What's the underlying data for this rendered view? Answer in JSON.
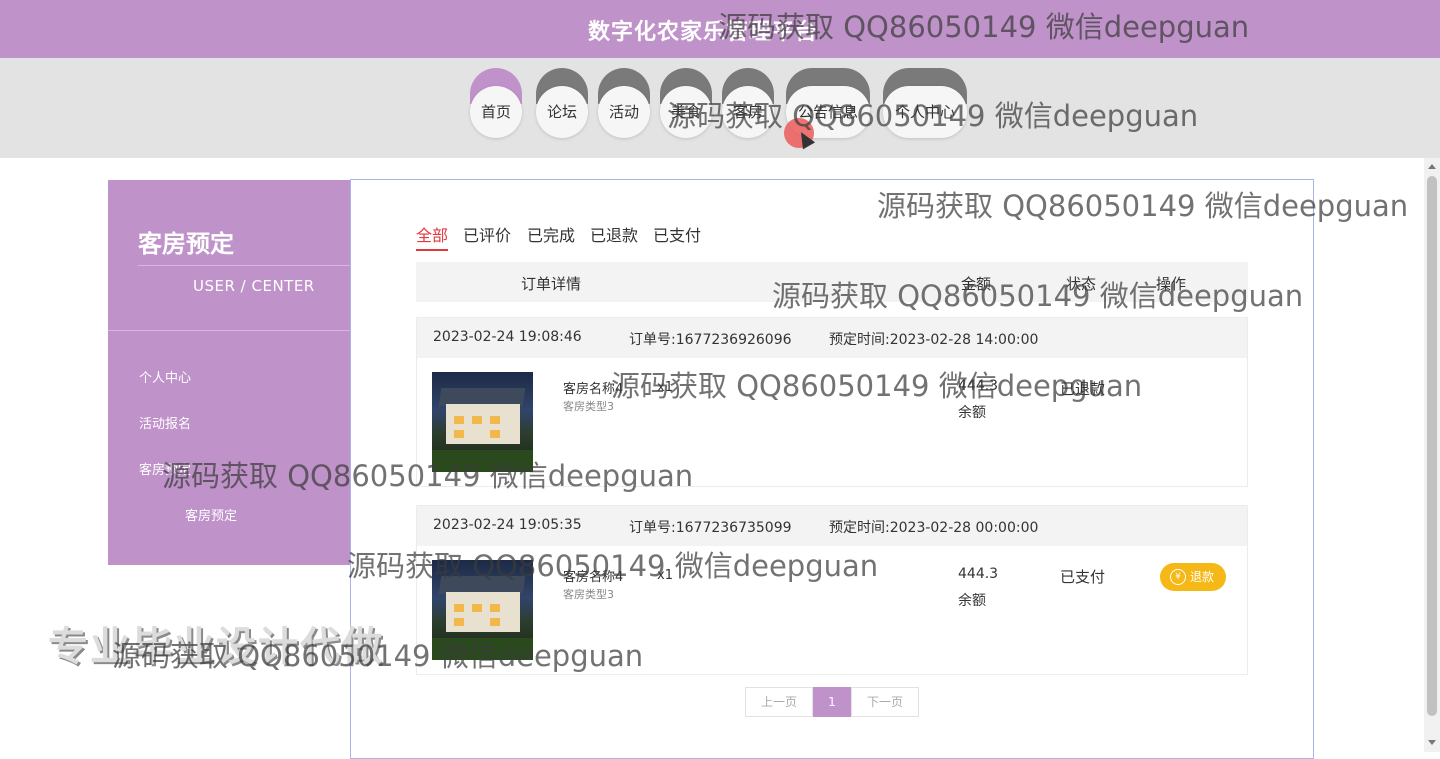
{
  "header": {
    "title": "数字化农家乐管理平台"
  },
  "nav": [
    {
      "label": "首页",
      "active": true
    },
    {
      "label": "论坛"
    },
    {
      "label": "活动"
    },
    {
      "label": "美食"
    },
    {
      "label": "客房"
    },
    {
      "label": "公告信息"
    },
    {
      "label": "个人中心"
    }
  ],
  "sidebar": {
    "title": "客房预定",
    "subtitle": "USER / CENTER",
    "items": [
      "个人中心",
      "活动报名",
      "客房预定",
      "客房预定"
    ]
  },
  "tabs": [
    "全部",
    "已评价",
    "已完成",
    "已退款",
    "已支付"
  ],
  "table_headers": {
    "details": "订单详情",
    "amount": "金额",
    "status": "状态",
    "action": "操作"
  },
  "orders": [
    {
      "created": "2023-02-24 19:08:46",
      "order_no": "订单号:1677236926096",
      "booking_time": "预定时间:2023-02-28 14:00:00",
      "item_name": "客房名称4",
      "qty": "x1",
      "item_type": "客房类型3",
      "amount": "444.3",
      "balance": "余额",
      "status": "已退款"
    },
    {
      "created": "2023-02-24 19:05:35",
      "order_no": "订单号:1677236735099",
      "booking_time": "预定时间:2023-02-28 00:00:00",
      "item_name": "客房名称4",
      "qty": "x1",
      "item_type": "客房类型3",
      "amount": "444.3",
      "balance": "余额",
      "status": "已支付",
      "action": "退款",
      "action_icon": "¥"
    }
  ],
  "pagination": {
    "prev": "上一页",
    "current": "1",
    "next": "下一页"
  },
  "watermarks": [
    "源码获取 QQ86050149 微信deepguan",
    "源码获取 QQ86050149 微信deepguan",
    "源码获取 QQ86050149 微信deepguan",
    "源码获取 QQ86050149 微信deepguan",
    "源码获取 QQ86050149 微信deepguan",
    "源码获取 QQ86050149 微信deepguan",
    "源码获取 QQ86050149 微信deepguan",
    "源码获取 QQ86050149 微信deepguan"
  ],
  "overlay_text": "专业毕业设计代做",
  "colors": {
    "brand": "#bf92c9",
    "accent_red": "#e0393e",
    "refund_yellow": "#f6b816"
  }
}
